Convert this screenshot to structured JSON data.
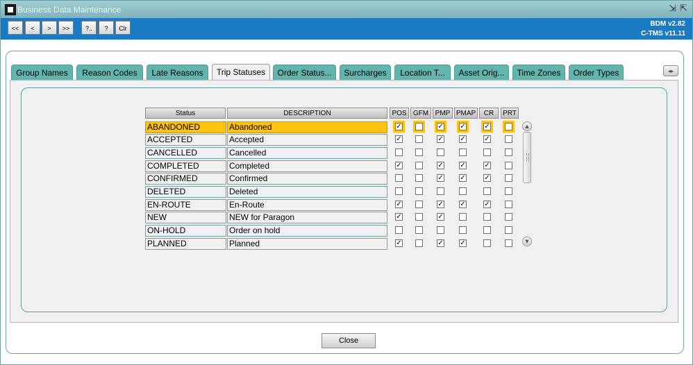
{
  "window": {
    "title": "Business Data Maintenance",
    "minimize_glyph": "⇲",
    "maximize_glyph": "⇱"
  },
  "toolbar": {
    "buttons": [
      "<<",
      "<",
      ">",
      ">>",
      "?..",
      "?",
      "Clr"
    ],
    "version_line1": "BDM v2.82",
    "version_line2": "C-TMS v11.11"
  },
  "tabs": [
    {
      "label": "Group Names",
      "active": false
    },
    {
      "label": "Reason Codes",
      "active": false
    },
    {
      "label": "Late Reasons",
      "active": false
    },
    {
      "label": "Trip Statuses",
      "active": true
    },
    {
      "label": "Order Status...",
      "active": false
    },
    {
      "label": "Surcharges",
      "active": false
    },
    {
      "label": "Location T...",
      "active": false
    },
    {
      "label": "Asset Orig...",
      "active": false
    },
    {
      "label": "Time Zones",
      "active": false
    },
    {
      "label": "Order Types",
      "active": false
    }
  ],
  "table": {
    "columns": [
      "Status",
      "DESCRIPTION",
      "POS",
      "GFM",
      "PMP",
      "PMAP",
      "CR",
      "PRT"
    ],
    "rows": [
      {
        "status": "ABANDONED",
        "description": "Abandoned",
        "flags": [
          true,
          false,
          true,
          true,
          true,
          false
        ],
        "selected": true
      },
      {
        "status": "ACCEPTED",
        "description": "Accepted",
        "flags": [
          true,
          false,
          true,
          true,
          true,
          false
        ],
        "selected": false
      },
      {
        "status": "CANCELLED",
        "description": "Cancelled",
        "flags": [
          false,
          false,
          false,
          false,
          false,
          false
        ],
        "selected": false
      },
      {
        "status": "COMPLETED",
        "description": "Completed",
        "flags": [
          true,
          false,
          true,
          true,
          true,
          false
        ],
        "selected": false
      },
      {
        "status": "CONFIRMED",
        "description": "Confirmed",
        "flags": [
          false,
          false,
          true,
          true,
          true,
          false
        ],
        "selected": false
      },
      {
        "status": "DELETED",
        "description": "Deleted",
        "flags": [
          false,
          false,
          false,
          false,
          false,
          false
        ],
        "selected": false
      },
      {
        "status": "EN-ROUTE",
        "description": "En-Route",
        "flags": [
          true,
          false,
          true,
          true,
          true,
          false
        ],
        "selected": false
      },
      {
        "status": "NEW",
        "description": "NEW for Paragon",
        "flags": [
          true,
          false,
          true,
          false,
          false,
          false
        ],
        "selected": false
      },
      {
        "status": "ON-HOLD",
        "description": "Order on hold",
        "flags": [
          false,
          false,
          false,
          false,
          false,
          false
        ],
        "selected": false
      },
      {
        "status": "PLANNED",
        "description": "Planned",
        "flags": [
          true,
          false,
          true,
          true,
          false,
          false
        ],
        "selected": false
      }
    ]
  },
  "scroll_up_glyph": "▲",
  "scroll_down_glyph": "▼",
  "tab_scroll_glyph": "◂▸",
  "close_label": "Close",
  "colors": {
    "accent_toolbar": "#1a7ac4",
    "tab": "#62b5ae",
    "selection": "#ffc20e"
  }
}
